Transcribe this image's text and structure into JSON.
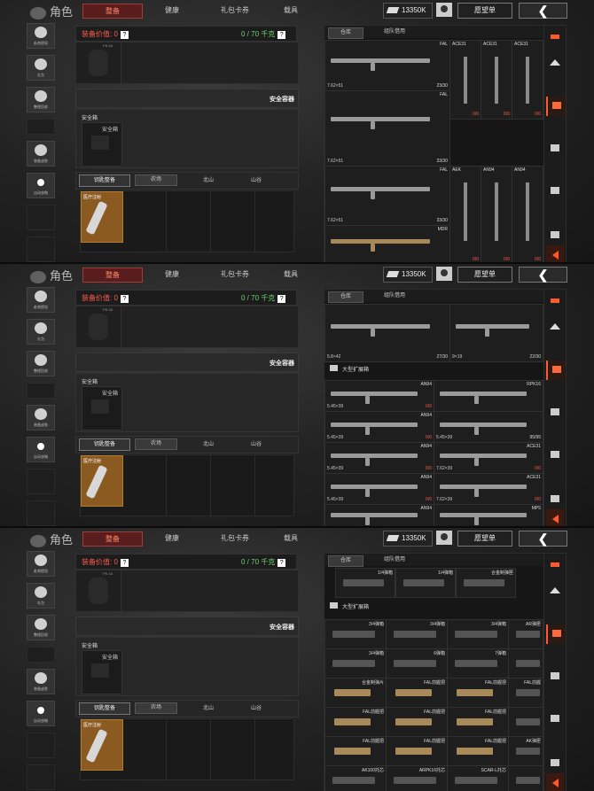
{
  "screens": [
    {
      "topbar": {
        "title": "角色",
        "tabs": [
          "整备",
          "健康",
          "礼包卡券",
          "载具"
        ],
        "active_tab": 0,
        "coins": "13350K",
        "wishlist": "愿望单",
        "back": "❮"
      },
      "left_buttons": [
        "赴商提现",
        "礼包",
        "整理回收",
        "装备皮肤",
        "自动攻略"
      ],
      "equip_value": "装备价值: 0",
      "weight": "0 / 70 千克",
      "slot_label": "PB 6A",
      "safe_container": "安全容器",
      "safe_box": "安全箱",
      "safe_box_inner": "安全箱",
      "key_button": "钥匙整备",
      "maps": [
        "农场",
        "北山",
        "山谷"
      ],
      "card_label": "医疗注射",
      "right_tabs": [
        "仓库",
        "组队借用"
      ],
      "items": [
        {
          "name": "FAL",
          "cal": "7.62×51",
          "count": "23/30"
        },
        {
          "name": "ACE31",
          "count": "0/0"
        },
        {
          "name": "ACE31",
          "count": "0/0"
        },
        {
          "name": "ACE31",
          "count": "0/0"
        },
        {
          "name": "FAL",
          "cal": "7.62×51",
          "count": "33/30"
        },
        {
          "name": "FAL",
          "cal": "7.62×51",
          "count": "33/30"
        },
        {
          "name": "AEK",
          "count": "0/0"
        },
        {
          "name": "AN94",
          "count": "0/0"
        },
        {
          "name": "AN94",
          "count": "0/0"
        },
        {
          "name": "MDR"
        }
      ]
    },
    {
      "topbar": {
        "title": "角色",
        "tabs": [
          "整备",
          "健康",
          "礼包卡券",
          "载具"
        ],
        "active_tab": 0,
        "coins": "13350K",
        "wishlist": "愿望单",
        "back": "❮"
      },
      "left_buttons": [
        "赴商提现",
        "礼包",
        "整理回收",
        "装备皮肤",
        "自动攻略"
      ],
      "equip_value": "装备价值: 0",
      "weight": "0 / 70 千克",
      "slot_label": "PB 6A",
      "safe_container": "安全容器",
      "safe_box": "安全箱",
      "safe_box_inner": "安全箱",
      "key_button": "钥匙整备",
      "maps": [
        "农场",
        "北山",
        "山谷"
      ],
      "card_label": "医疗注射",
      "right_tabs": [
        "仓库",
        "组队借用"
      ],
      "section": "大型扩展箱",
      "items": [
        {
          "cal": "5.8×42",
          "count": "27/30"
        },
        {
          "cal": "9×19",
          "count": "22/30"
        },
        {
          "name": "AN94",
          "cal": "5.45×39",
          "count": "0/0"
        },
        {
          "name": "RPK16",
          "cal": "",
          "count": ""
        },
        {
          "name": "AN94",
          "cal": "5.45×39",
          "count": "0/0"
        },
        {
          "name": "",
          "cal": "5.45×39",
          "count": "95/95"
        },
        {
          "name": "AN94",
          "cal": "5.45×39",
          "count": "0/0"
        },
        {
          "name": "ACE31",
          "cal": "7.62×39",
          "count": "0/0"
        },
        {
          "name": "AN94",
          "cal": "5.45×39",
          "count": "0/0"
        },
        {
          "name": "ACE31",
          "cal": "7.62×39",
          "count": "0/0"
        },
        {
          "name": "AN94"
        },
        {
          "name": "MP5"
        }
      ]
    },
    {
      "topbar": {
        "title": "角色",
        "tabs": [
          "整备",
          "健康",
          "礼包卡券",
          "载具"
        ],
        "active_tab": 0,
        "coins": "13350K",
        "wishlist": "愿望单",
        "back": "❮"
      },
      "left_buttons": [
        "赴商提现",
        "礼包",
        "整理回收",
        "装备皮肤",
        "自动攻略"
      ],
      "equip_value": "装备价值: 0",
      "weight": "0 / 70 千克",
      "slot_label": "PB 6A",
      "safe_container": "安全容器",
      "safe_box": "安全箱",
      "safe_box_inner": "安全箱",
      "key_button": "钥匙整备",
      "maps": [
        "农场",
        "北山",
        "山谷"
      ],
      "card_label": "医疗注射",
      "right_tabs": [
        "仓库",
        "组队借用"
      ],
      "section": "大型扩展箱",
      "top_items": [
        "1/4弹箱",
        "1/4弹箱",
        "合金制弹匣"
      ],
      "items": [
        {
          "name": "3/4弹箱"
        },
        {
          "name": "3/4弹箱"
        },
        {
          "name": "3/4弹箱"
        },
        {
          "name": "AR弹匣"
        },
        {
          "name": "3/4弹箱"
        },
        {
          "name": "6弹箱"
        },
        {
          "name": "7弹箱"
        },
        {
          "name": ""
        },
        {
          "name": "合金制弹片"
        },
        {
          "name": "FAL前握把"
        },
        {
          "name": "FAL前握把"
        },
        {
          "name": "FAL前握"
        },
        {
          "name": "FAL前握把"
        },
        {
          "name": "FAL前握把"
        },
        {
          "name": "FAL前握把"
        },
        {
          "name": ""
        },
        {
          "name": "FAL前握把"
        },
        {
          "name": "FAL前握把"
        },
        {
          "name": "FAL前握把"
        },
        {
          "name": "AK弹匣"
        },
        {
          "name": "AK100托芯"
        },
        {
          "name": "ARPK16托芯"
        },
        {
          "name": "SCAR-L托芯"
        },
        {
          "name": ""
        }
      ]
    }
  ],
  "colors": {
    "accent": "#ff5a2a",
    "weight": "#6ed36e",
    "value": "#ff5a4a",
    "active_tab_bg": "#5a1d1d"
  }
}
